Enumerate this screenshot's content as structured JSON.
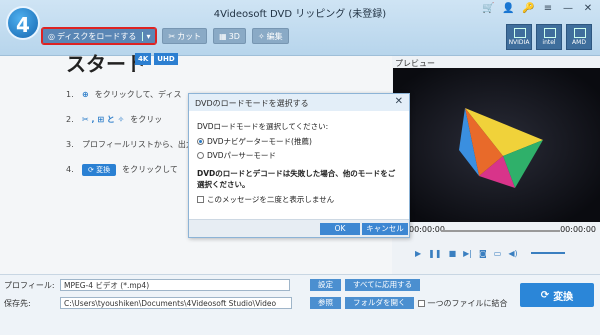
{
  "app": {
    "title": "4Videosoft DVD リッピング (未登録)",
    "logo": "4"
  },
  "window_controls": [
    "🛒",
    "👤",
    "🔑",
    "≡",
    "—",
    "✕"
  ],
  "toolbar": {
    "load_disc": "ディスクをロードする",
    "dropdown": "▾",
    "cut": "カット",
    "three_d": "3D",
    "edit": "編集"
  },
  "accelerators": [
    "NVIDIA",
    "intel",
    "AMD"
  ],
  "main": {
    "start_title": "スタート",
    "badges": [
      "4K",
      "UHD"
    ],
    "steps": [
      {
        "n": "1.",
        "icon": "⊕",
        "text": "をクリックして、ディス"
      },
      {
        "n": "2.",
        "icon": "✂ ,  ⊞  と  ✧",
        "text": "をクリッ"
      },
      {
        "n": "3.",
        "icon": "",
        "text": "プロフィールリストから、出力"
      },
      {
        "n": "4.",
        "icon": "",
        "button": "⟳ 変換",
        "text": "をクリックして"
      }
    ]
  },
  "preview": {
    "label": "プレビュー",
    "time_start": "00:00:00",
    "time_end": "00:00:00"
  },
  "dialog": {
    "title": "DVDのロードモードを選択する",
    "question": "DVDロードモードを選択してください:",
    "options": [
      "DVDナビゲーターモード(推薦)",
      "DVDパーサーモード"
    ],
    "selected_index": 0,
    "warning": "DVDのロードとデコードは失敗した場合、他のモードをご選択ください。",
    "checkbox": "このメッセージを二度と表示しません",
    "ok": "OK",
    "cancel": "キャンセル"
  },
  "bottom": {
    "profile_label": "プロフィール:",
    "profile_value": "MPEG-4 ビデオ (*.mp4)",
    "settings": "設定",
    "apply_all": "すべてに応用する",
    "dest_label": "保存先:",
    "dest_value": "C:\\Users\\tyoushiken\\Documents\\4Videosoft Studio\\Video",
    "browse": "参照",
    "open_folder": "フォルダを開く",
    "merge_checkbox": "一つのファイルに結合",
    "convert": "変換"
  }
}
